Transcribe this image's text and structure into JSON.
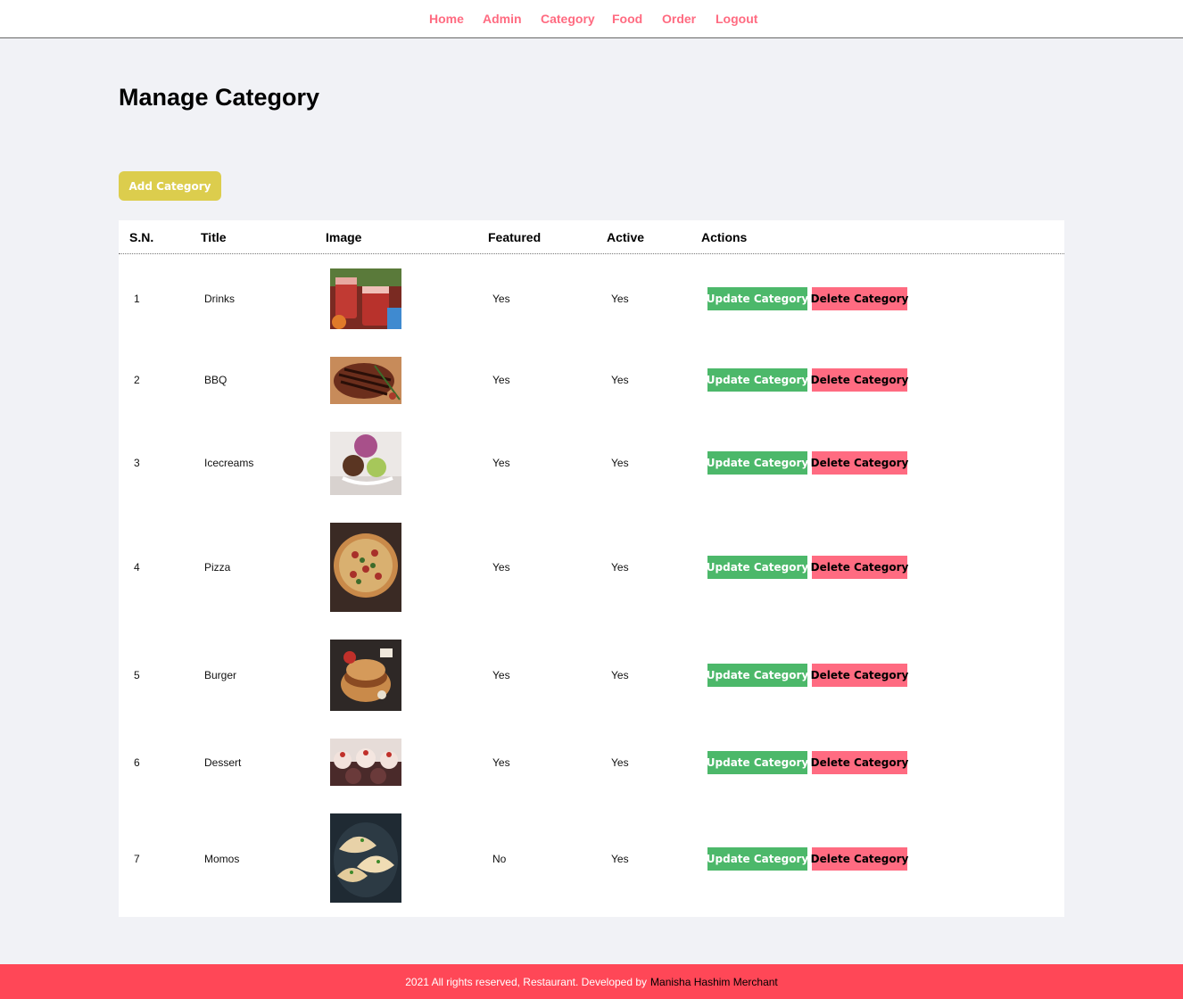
{
  "nav": {
    "items": [
      "Home",
      "Admin",
      "Category",
      "Food",
      "Order",
      "Logout"
    ]
  },
  "page": {
    "title": "Manage Category",
    "add_button": "Add Category"
  },
  "table": {
    "headers": [
      "S.N.",
      "Title",
      "Image",
      "Featured",
      "Active",
      "Actions"
    ],
    "update_label": "Update Category",
    "delete_label": "Delete Category",
    "rows": [
      {
        "sn": "1",
        "title": "Drinks",
        "image": "drinks-image",
        "featured": "Yes",
        "active": "Yes"
      },
      {
        "sn": "2",
        "title": "BBQ",
        "image": "bbq-image",
        "featured": "Yes",
        "active": "Yes"
      },
      {
        "sn": "3",
        "title": "Icecreams",
        "image": "icecreams-image",
        "featured": "Yes",
        "active": "Yes"
      },
      {
        "sn": "4",
        "title": "Pizza",
        "image": "pizza-image",
        "featured": "Yes",
        "active": "Yes"
      },
      {
        "sn": "5",
        "title": "Burger",
        "image": "burger-image",
        "featured": "Yes",
        "active": "Yes"
      },
      {
        "sn": "6",
        "title": "Dessert",
        "image": "dessert-image",
        "featured": "Yes",
        "active": "Yes"
      },
      {
        "sn": "7",
        "title": "Momos",
        "image": "momos-image",
        "featured": "No",
        "active": "Yes"
      }
    ]
  },
  "footer": {
    "text": "2021 All rights reserved, Restaurant. Developed by",
    "author": "Manisha Hashim Merchant"
  },
  "colors": {
    "nav_link": "#ff6b81",
    "page_bg": "#f1f2f6",
    "add_button": "#dccd4d",
    "update_button": "#4cb86a",
    "delete_button": "#ff6b81",
    "footer_bg": "#ff4757"
  }
}
